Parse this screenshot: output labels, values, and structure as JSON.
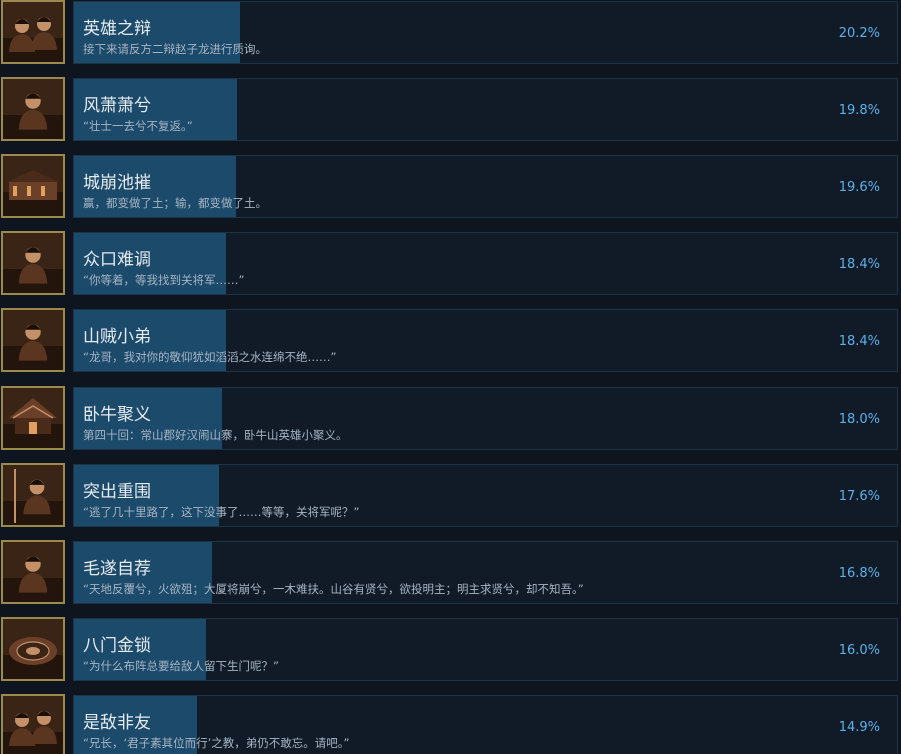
{
  "colors": {
    "background": "#0f151e",
    "panel": "#111b27",
    "panel_border": "#1c3446",
    "progress_bar": "#1c4a6b",
    "icon_frame": "#9a8a4e",
    "title_text": "#e6ebf0",
    "description_text": "#a6b5c3",
    "percent_text": "#5db0ea"
  },
  "achievements": [
    {
      "title": "英雄之辩",
      "description": "接下来请反方二辩赵子龙进行质询。",
      "percent": "20.2%",
      "value": 20.2,
      "icon": "two-heroes-portrait-icon"
    },
    {
      "title": "风萧萧兮",
      "description": "“壮士一去兮不复返。”",
      "percent": "19.8%",
      "value": 19.8,
      "icon": "warrior-portrait-icon"
    },
    {
      "title": "城崩池摧",
      "description": "赢，都变做了土；输，都变做了土。",
      "percent": "19.6%",
      "value": 19.6,
      "icon": "ruined-city-icon"
    },
    {
      "title": "众口难调",
      "description": "“你等着，等我找到关将军……”",
      "percent": "18.4%",
      "value": 18.4,
      "icon": "armored-general-icon"
    },
    {
      "title": "山贼小弟",
      "description": "“龙哥，我对你的敬仰犹如滔滔之水连绵不绝……”",
      "percent": "18.4%",
      "value": 18.4,
      "icon": "bandit-portrait-icon"
    },
    {
      "title": "卧牛聚义",
      "description": "第四十回：常山郡好汉闹山寨，卧牛山英雄小聚义。",
      "percent": "18.0%",
      "value": 18.0,
      "icon": "mountain-fortress-icon"
    },
    {
      "title": "突出重围",
      "description": "“逃了几十里路了，这下没事了……等等，关将军呢？”",
      "percent": "17.6%",
      "value": 17.6,
      "icon": "spear-general-icon"
    },
    {
      "title": "毛遂自荐",
      "description": "“天地反覆兮，火欲殂；大厦将崩兮，一木难扶。山谷有贤兮，欲投明主；明主求贤兮，却不知吾。”",
      "percent": "16.8%",
      "value": 16.8,
      "icon": "scholar-portrait-icon"
    },
    {
      "title": "八门金锁",
      "description": "“为什么布阵总要给敌人留下生门呢？”",
      "percent": "16.0%",
      "value": 16.0,
      "icon": "battle-formation-icon"
    },
    {
      "title": "是敌非友",
      "description": "“兄长，‘君子素其位而行’之教，弟仍不敢忘。请吧。”",
      "percent": "14.9%",
      "value": 14.9,
      "icon": "two-rivals-portrait-icon"
    }
  ]
}
